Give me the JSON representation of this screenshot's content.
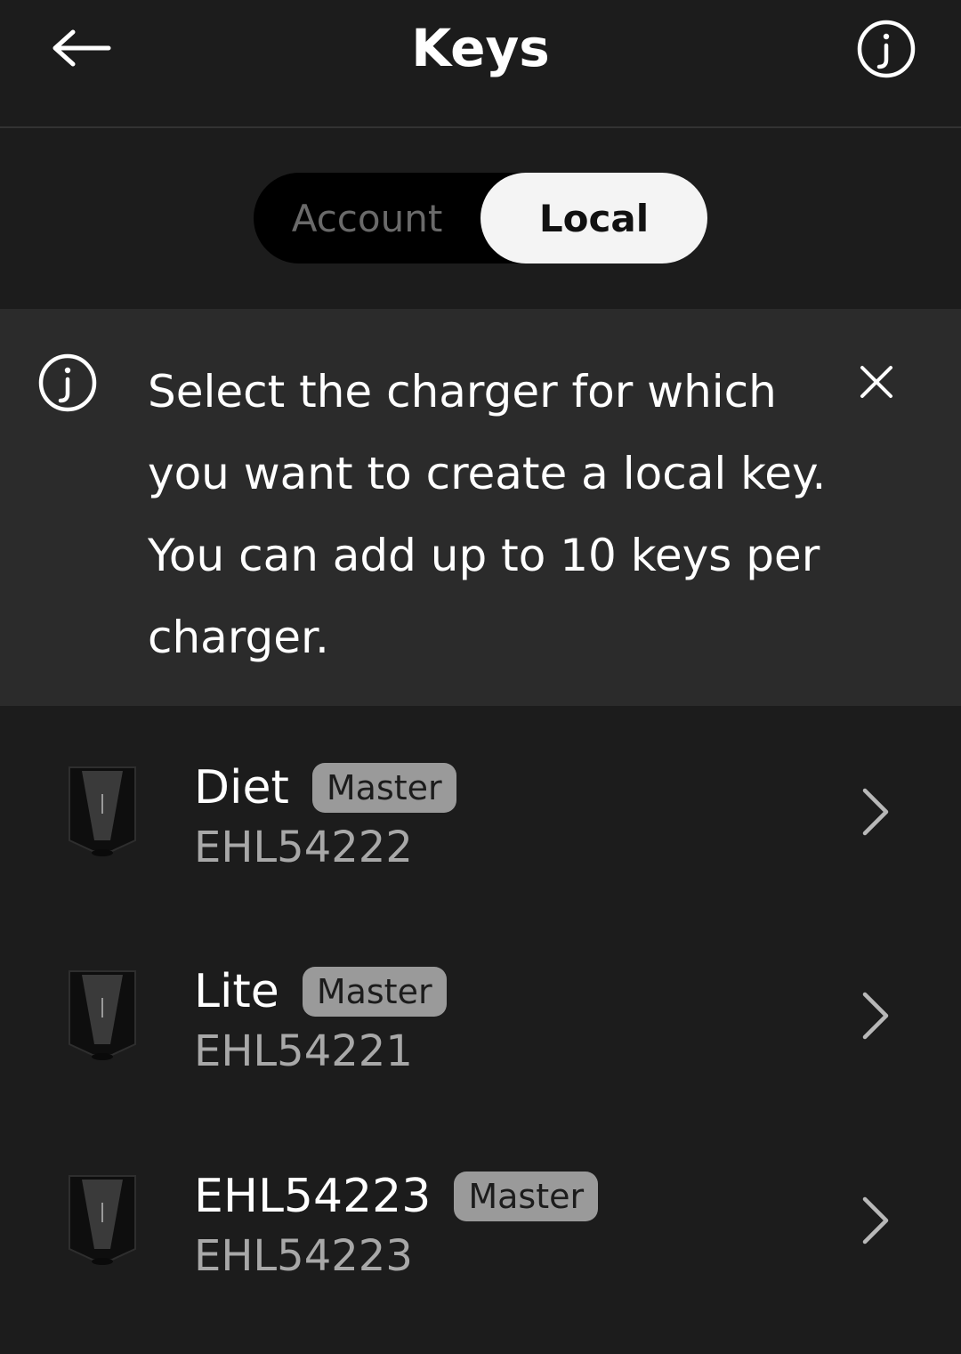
{
  "header": {
    "title": "Keys",
    "back_icon": "back-arrow-icon",
    "info_icon": "info-icon"
  },
  "tabs": {
    "items": [
      {
        "label": "Account",
        "selected": false
      },
      {
        "label": "Local",
        "selected": true
      }
    ]
  },
  "banner": {
    "icon": "info-icon",
    "text": "Select the charger for which you want to create a local key. You can add up to 10 keys per charger.",
    "close_icon": "close-icon"
  },
  "chargers": [
    {
      "name": "Diet",
      "badge": "Master",
      "serial": "EHL54222"
    },
    {
      "name": "Lite",
      "badge": "Master",
      "serial": "EHL54221"
    },
    {
      "name": "EHL54223",
      "badge": "Master",
      "serial": "EHL54223"
    }
  ],
  "colors": {
    "background": "#1c1c1c",
    "banner_background": "#2b2b2b",
    "badge_background": "#9a9a9a",
    "selected_tab": "#f4f4f4"
  }
}
